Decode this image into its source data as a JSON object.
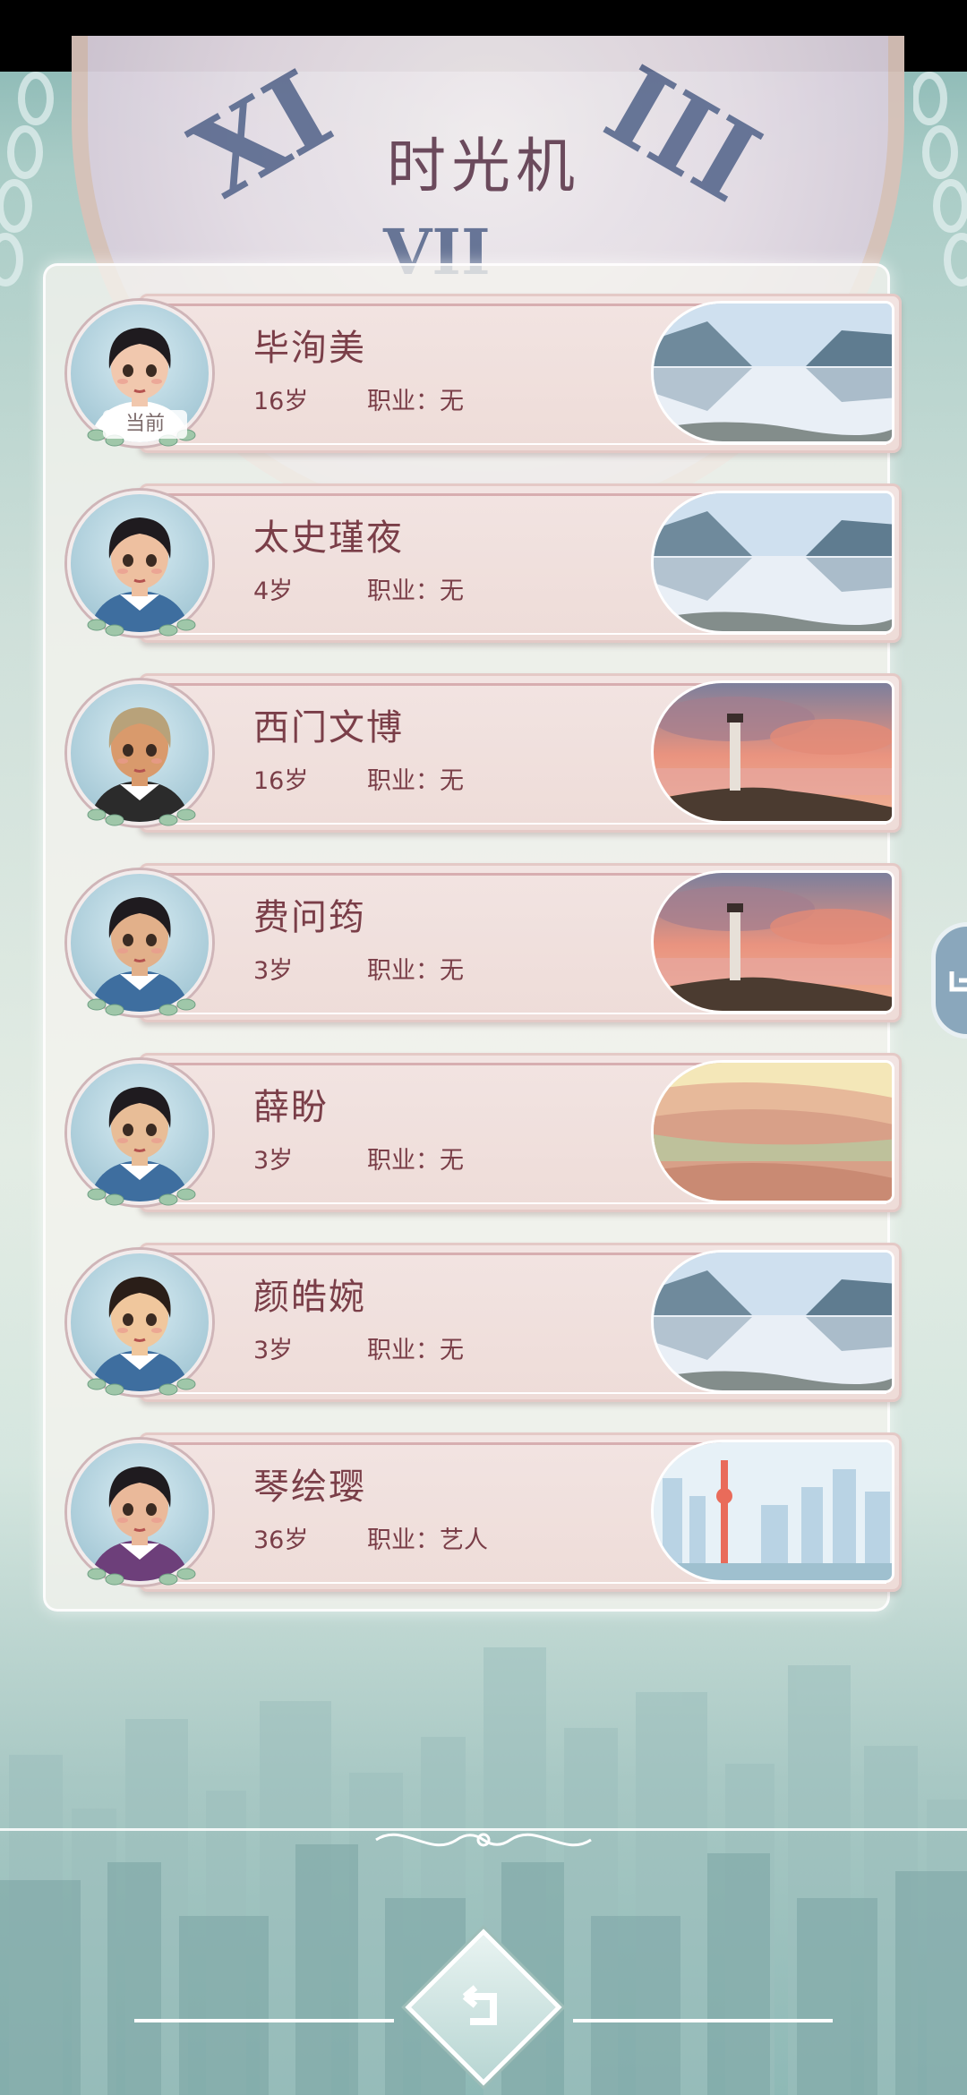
{
  "title": "时光机",
  "current_label": "当前",
  "job_prefix": "职业：",
  "characters": [
    {
      "name": "毕洵美",
      "age": "16岁",
      "job": "无",
      "scene": "lake",
      "hair": "#1f1b1f",
      "skin": "#f1c8ae",
      "shirt": "#ffffff"
    },
    {
      "name": "太史瑾夜",
      "age": "4岁",
      "job": "无",
      "scene": "lake",
      "hair": "#1f1b1f",
      "skin": "#eec0a0",
      "shirt": "#3e6e9f"
    },
    {
      "name": "西门文博",
      "age": "16岁",
      "job": "无",
      "scene": "lighthouse",
      "hair": "#b8a27a",
      "skin": "#d99a6c",
      "shirt": "#2b2b2b"
    },
    {
      "name": "费问筠",
      "age": "3岁",
      "job": "无",
      "scene": "lighthouse",
      "hair": "#1f1b1f",
      "skin": "#e2b08a",
      "shirt": "#3e6e9f"
    },
    {
      "name": "薛盼",
      "age": "3岁",
      "job": "无",
      "scene": "desert",
      "hair": "#1f1b1f",
      "skin": "#e8bd97",
      "shirt": "#3e6e9f"
    },
    {
      "name": "颜皓婉",
      "age": "3岁",
      "job": "无",
      "scene": "lake",
      "hair": "#2a1e18",
      "skin": "#f0c79d",
      "shirt": "#3e6e9f"
    },
    {
      "name": "琴绘璎",
      "age": "36岁",
      "job": "艺人",
      "scene": "city",
      "hair": "#1f1b1f",
      "skin": "#eab99a",
      "shirt": "#6d3f7a"
    }
  ]
}
